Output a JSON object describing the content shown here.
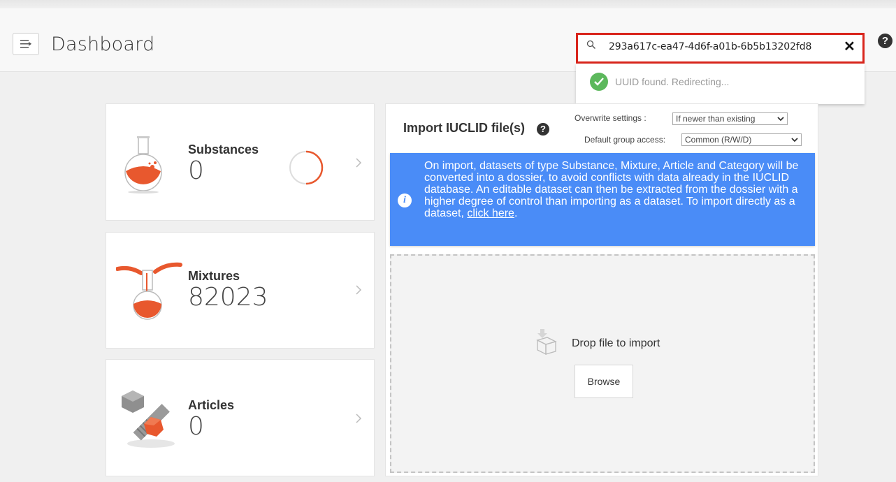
{
  "header": {
    "title": "Dashboard",
    "menu_icon": "menu-icon",
    "help_icon": "help-icon",
    "help_glyph": "?"
  },
  "search": {
    "value": "293a617c-ea47-4d6f-a01b-6b5b13202fd8",
    "clear_glyph": "✕",
    "status": "UUID found. Redirecting...",
    "highlight_color": "#d9251c"
  },
  "cards": {
    "substances": {
      "label": "Substances",
      "count": "0"
    },
    "mixtures": {
      "label": "Mixtures",
      "count": "82023"
    },
    "articles": {
      "label": "Articles",
      "count": "0"
    }
  },
  "import": {
    "title": "Import IUCLID file(s)",
    "help_glyph": "?",
    "overwrite_label": "Overwrite settings :",
    "overwrite_value": "If newer than existing",
    "group_access_label": "Default group access:",
    "group_access_value": "Common (R/W/D)",
    "info_icon_glyph": "i",
    "info_text": "On import, datasets of type Substance, Mixture, Article and Category will be converted into a dossier, to avoid conflicts with data already in the IUCLID database. An editable dataset can then be extracted from the dossier with a higher degree of control than importing as a dataset. To import directly as a dataset, ",
    "info_link": "click here",
    "info_end": ".",
    "drop_text": "Drop file to import",
    "browse_label": "Browse"
  },
  "colors": {
    "accent": "#e8582e",
    "info_blue": "#4a8cf7",
    "success": "#5cb85c"
  }
}
